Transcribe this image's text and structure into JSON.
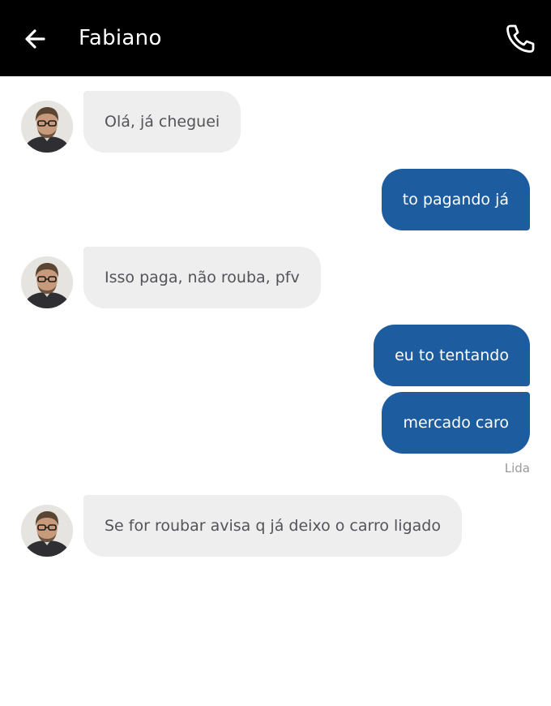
{
  "header": {
    "title": "Fabiano",
    "back_icon": "arrow-left-icon",
    "call_icon": "phone-icon",
    "background": "#000000"
  },
  "messages": [
    {
      "direction": "incoming",
      "text": "Olá, já cheguei"
    },
    {
      "direction": "outgoing",
      "text": "to pagando já"
    },
    {
      "direction": "incoming",
      "text": "Isso paga, não rouba, pfv"
    },
    {
      "direction": "outgoing",
      "text": "eu to tentando"
    },
    {
      "direction": "outgoing",
      "text": "mercado caro"
    },
    {
      "direction": "incoming",
      "text": "Se for roubar avisa q já deixo o carro ligado"
    }
  ],
  "read_status": "Lida",
  "colors": {
    "incoming_bubble": "#eeeeef",
    "incoming_text": "#545458",
    "outgoing_bubble": "#1d5c9f",
    "outgoing_text": "#ffffff",
    "status_text": "#9a9a9e"
  }
}
